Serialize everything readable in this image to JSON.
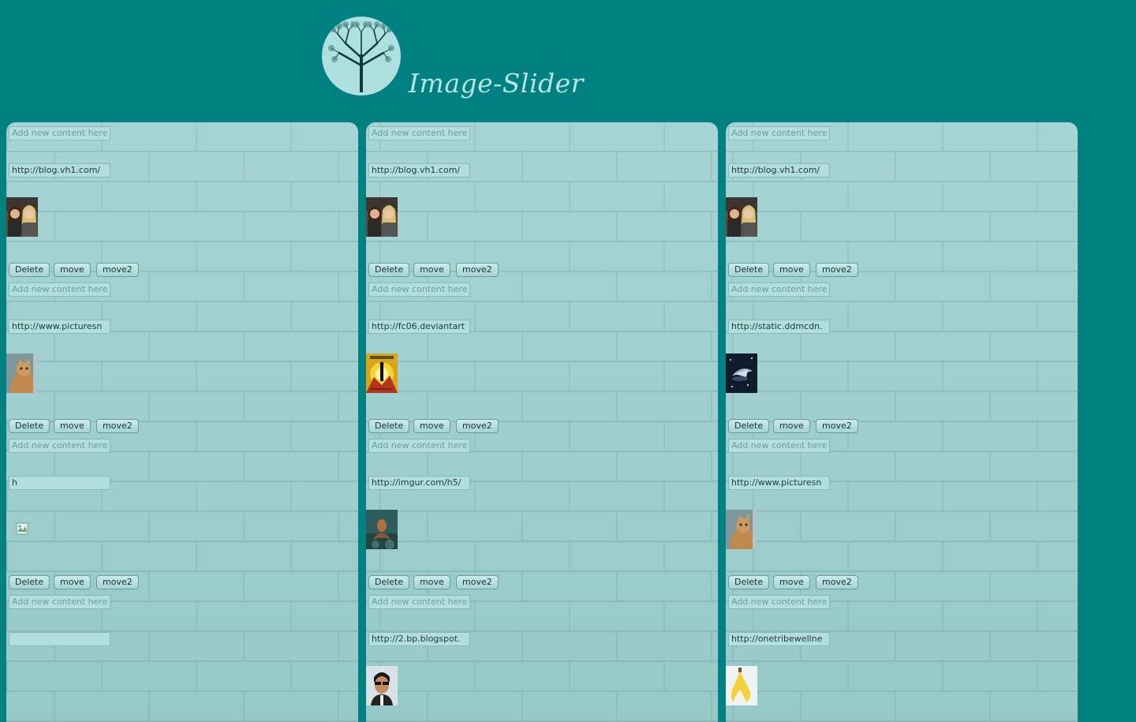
{
  "header": {
    "title": "Image-Slider",
    "logo_icon": "tree-icon"
  },
  "content_placeholder": "Add new content here",
  "buttons": {
    "delete": "Delete",
    "move": "move",
    "move2": "move2"
  },
  "columns": [
    {
      "items": [
        {
          "url": "http://blog.vh1.com/",
          "thumb": "two-women-photo"
        },
        {
          "url": "http://www.picturesn",
          "thumb": "cat-photo"
        },
        {
          "url": "h",
          "thumb": "broken-image-icon"
        },
        {
          "url": "",
          "thumb": "empty-thumbnail"
        }
      ]
    },
    {
      "items": [
        {
          "url": "http://blog.vh1.com/",
          "thumb": "two-women-photo"
        },
        {
          "url": "http://fc06.deviantart",
          "thumb": "cool-guys-poster"
        },
        {
          "url": "http://imgur.com/h5/",
          "thumb": "octopus-photo"
        },
        {
          "url": "http://2.bp.blogspot.",
          "thumb": "man-portrait-photo"
        }
      ]
    },
    {
      "items": [
        {
          "url": "http://blog.vh1.com/",
          "thumb": "two-women-photo"
        },
        {
          "url": "http://static.ddmcdn.",
          "thumb": "spaceship-photo"
        },
        {
          "url": "http://www.picturesn",
          "thumb": "cat-photo"
        },
        {
          "url": "http://onetribewellne",
          "thumb": "banana-photo"
        }
      ]
    }
  ],
  "colors": {
    "background": "#008080",
    "panel": "#9fcfcf",
    "title": "#b4e4e4"
  }
}
